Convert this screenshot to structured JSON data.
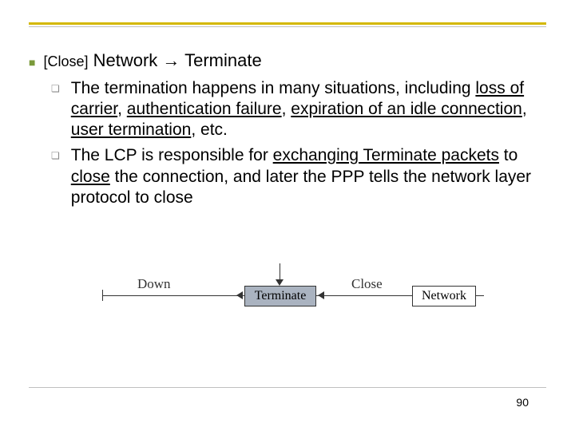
{
  "main": {
    "bracket": "[Close]",
    "title_rest": " Network → Terminate",
    "sub1_a": "The termination happens in many situations, including ",
    "sub1_u1": "loss of carrier",
    "sub1_b": ", ",
    "sub1_u2": "authentication failure",
    "sub1_c": ", ",
    "sub1_u3": "expiration of an idle connection",
    "sub1_d": ", ",
    "sub1_u4": "user termination",
    "sub1_e": ", etc.",
    "sub2_a": "The LCP is responsible for ",
    "sub2_u1": "exchanging Terminate packets",
    "sub2_b": " to ",
    "sub2_u2": "close",
    "sub2_c": " the connection, and later the PPP tells the network layer protocol to close"
  },
  "diagram": {
    "down": "Down",
    "terminate": "Terminate",
    "network": "Network",
    "close": "Close"
  },
  "page": "90"
}
